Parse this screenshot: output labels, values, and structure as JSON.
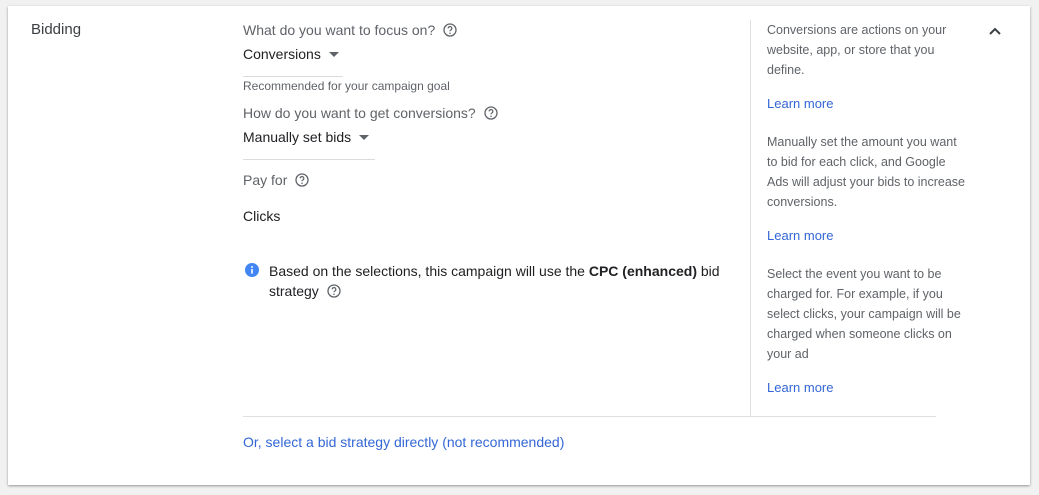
{
  "section": {
    "title": "Bidding"
  },
  "focus": {
    "label": "What do you want to focus on?",
    "value": "Conversions",
    "hint": "Recommended for your campaign goal"
  },
  "conversions": {
    "label": "How do you want to get conversions?",
    "value": "Manually set bids"
  },
  "pay_for": {
    "label": "Pay for",
    "value": "Clicks"
  },
  "info": {
    "prefix": "Based on the selections, this campaign will use the",
    "strategy": "CPC (enhanced)",
    "suffix": "bid strategy"
  },
  "side_help": [
    {
      "text": "Conversions are actions on your website, app, or store that you define.",
      "link": "Learn more"
    },
    {
      "text": "Manually set the amount you want to bid for each click, and Google Ads will adjust your bids to increase conversions.",
      "link": "Learn more"
    },
    {
      "text": "Select the event you want to be charged for. For example, if you select clicks, your campaign will be charged when someone clicks on your ad",
      "link": "Learn more"
    }
  ],
  "bottom_link": "Or, select a bid strategy directly (not recommended)",
  "icons": {
    "help": "help-circle-icon",
    "info": "info-icon",
    "collapse": "chevron-up-icon",
    "dropdown": "caret-down-icon"
  },
  "colors": {
    "link": "#3367d6",
    "info": "#4285f4",
    "text_primary": "#202124",
    "text_secondary": "#5f6368"
  }
}
